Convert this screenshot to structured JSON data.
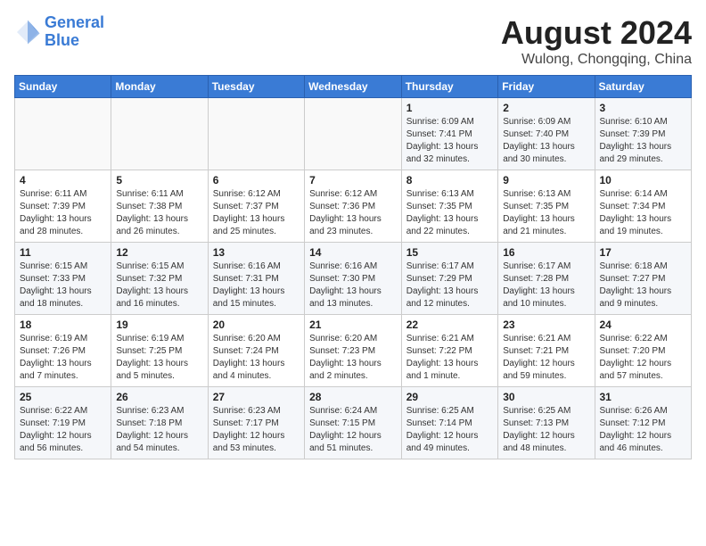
{
  "header": {
    "logo_line1": "General",
    "logo_line2": "Blue",
    "month_year": "August 2024",
    "location": "Wulong, Chongqing, China"
  },
  "days_of_week": [
    "Sunday",
    "Monday",
    "Tuesday",
    "Wednesday",
    "Thursday",
    "Friday",
    "Saturday"
  ],
  "weeks": [
    [
      {
        "day": "",
        "info": ""
      },
      {
        "day": "",
        "info": ""
      },
      {
        "day": "",
        "info": ""
      },
      {
        "day": "",
        "info": ""
      },
      {
        "day": "1",
        "info": "Sunrise: 6:09 AM\nSunset: 7:41 PM\nDaylight: 13 hours\nand 32 minutes."
      },
      {
        "day": "2",
        "info": "Sunrise: 6:09 AM\nSunset: 7:40 PM\nDaylight: 13 hours\nand 30 minutes."
      },
      {
        "day": "3",
        "info": "Sunrise: 6:10 AM\nSunset: 7:39 PM\nDaylight: 13 hours\nand 29 minutes."
      }
    ],
    [
      {
        "day": "4",
        "info": "Sunrise: 6:11 AM\nSunset: 7:39 PM\nDaylight: 13 hours\nand 28 minutes."
      },
      {
        "day": "5",
        "info": "Sunrise: 6:11 AM\nSunset: 7:38 PM\nDaylight: 13 hours\nand 26 minutes."
      },
      {
        "day": "6",
        "info": "Sunrise: 6:12 AM\nSunset: 7:37 PM\nDaylight: 13 hours\nand 25 minutes."
      },
      {
        "day": "7",
        "info": "Sunrise: 6:12 AM\nSunset: 7:36 PM\nDaylight: 13 hours\nand 23 minutes."
      },
      {
        "day": "8",
        "info": "Sunrise: 6:13 AM\nSunset: 7:35 PM\nDaylight: 13 hours\nand 22 minutes."
      },
      {
        "day": "9",
        "info": "Sunrise: 6:13 AM\nSunset: 7:35 PM\nDaylight: 13 hours\nand 21 minutes."
      },
      {
        "day": "10",
        "info": "Sunrise: 6:14 AM\nSunset: 7:34 PM\nDaylight: 13 hours\nand 19 minutes."
      }
    ],
    [
      {
        "day": "11",
        "info": "Sunrise: 6:15 AM\nSunset: 7:33 PM\nDaylight: 13 hours\nand 18 minutes."
      },
      {
        "day": "12",
        "info": "Sunrise: 6:15 AM\nSunset: 7:32 PM\nDaylight: 13 hours\nand 16 minutes."
      },
      {
        "day": "13",
        "info": "Sunrise: 6:16 AM\nSunset: 7:31 PM\nDaylight: 13 hours\nand 15 minutes."
      },
      {
        "day": "14",
        "info": "Sunrise: 6:16 AM\nSunset: 7:30 PM\nDaylight: 13 hours\nand 13 minutes."
      },
      {
        "day": "15",
        "info": "Sunrise: 6:17 AM\nSunset: 7:29 PM\nDaylight: 13 hours\nand 12 minutes."
      },
      {
        "day": "16",
        "info": "Sunrise: 6:17 AM\nSunset: 7:28 PM\nDaylight: 13 hours\nand 10 minutes."
      },
      {
        "day": "17",
        "info": "Sunrise: 6:18 AM\nSunset: 7:27 PM\nDaylight: 13 hours\nand 9 minutes."
      }
    ],
    [
      {
        "day": "18",
        "info": "Sunrise: 6:19 AM\nSunset: 7:26 PM\nDaylight: 13 hours\nand 7 minutes."
      },
      {
        "day": "19",
        "info": "Sunrise: 6:19 AM\nSunset: 7:25 PM\nDaylight: 13 hours\nand 5 minutes."
      },
      {
        "day": "20",
        "info": "Sunrise: 6:20 AM\nSunset: 7:24 PM\nDaylight: 13 hours\nand 4 minutes."
      },
      {
        "day": "21",
        "info": "Sunrise: 6:20 AM\nSunset: 7:23 PM\nDaylight: 13 hours\nand 2 minutes."
      },
      {
        "day": "22",
        "info": "Sunrise: 6:21 AM\nSunset: 7:22 PM\nDaylight: 13 hours\nand 1 minute."
      },
      {
        "day": "23",
        "info": "Sunrise: 6:21 AM\nSunset: 7:21 PM\nDaylight: 12 hours\nand 59 minutes."
      },
      {
        "day": "24",
        "info": "Sunrise: 6:22 AM\nSunset: 7:20 PM\nDaylight: 12 hours\nand 57 minutes."
      }
    ],
    [
      {
        "day": "25",
        "info": "Sunrise: 6:22 AM\nSunset: 7:19 PM\nDaylight: 12 hours\nand 56 minutes."
      },
      {
        "day": "26",
        "info": "Sunrise: 6:23 AM\nSunset: 7:18 PM\nDaylight: 12 hours\nand 54 minutes."
      },
      {
        "day": "27",
        "info": "Sunrise: 6:23 AM\nSunset: 7:17 PM\nDaylight: 12 hours\nand 53 minutes."
      },
      {
        "day": "28",
        "info": "Sunrise: 6:24 AM\nSunset: 7:15 PM\nDaylight: 12 hours\nand 51 minutes."
      },
      {
        "day": "29",
        "info": "Sunrise: 6:25 AM\nSunset: 7:14 PM\nDaylight: 12 hours\nand 49 minutes."
      },
      {
        "day": "30",
        "info": "Sunrise: 6:25 AM\nSunset: 7:13 PM\nDaylight: 12 hours\nand 48 minutes."
      },
      {
        "day": "31",
        "info": "Sunrise: 6:26 AM\nSunset: 7:12 PM\nDaylight: 12 hours\nand 46 minutes."
      }
    ]
  ]
}
